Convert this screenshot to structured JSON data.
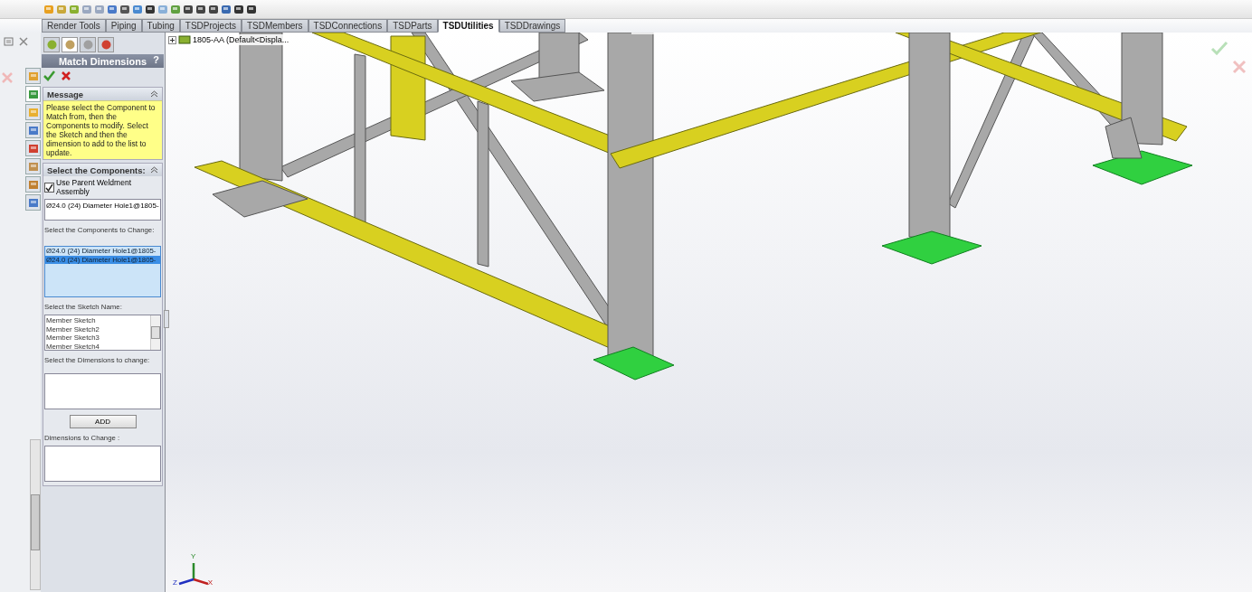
{
  "tabs": [
    {
      "label": "Render Tools",
      "selected": false
    },
    {
      "label": "Piping",
      "selected": false
    },
    {
      "label": "Tubing",
      "selected": false
    },
    {
      "label": "TSDProjects",
      "selected": false
    },
    {
      "label": "TSDMembers",
      "selected": false
    },
    {
      "label": "TSDConnections",
      "selected": false
    },
    {
      "label": "TSDParts",
      "selected": false
    },
    {
      "label": "TSDUtilities",
      "selected": true
    },
    {
      "label": "TSDDrawings",
      "selected": false
    }
  ],
  "side_tabs": [
    {
      "selected": false
    },
    {
      "selected": true
    },
    {
      "selected": false
    },
    {
      "selected": false
    },
    {
      "selected": false
    },
    {
      "selected": false
    },
    {
      "selected": false
    },
    {
      "selected": false
    }
  ],
  "panel_tabs": [
    {
      "selected": false
    },
    {
      "selected": true
    },
    {
      "selected": false
    },
    {
      "selected": false
    }
  ],
  "panel": {
    "title": "Match Dimensions",
    "help": "?",
    "message": {
      "heading": "Message",
      "text": "Please select the Component to Match from, then the Components to modify. Select the Sketch and then the dimension to add to the list to update."
    },
    "components": {
      "heading": "Select the Components:",
      "checkbox": {
        "label": "Use Parent Weldment Assembly",
        "checked": true
      },
      "field_value": "Ø24.0 (24) Diameter Hole1@1805-",
      "change_label": "Select the Components to Change:",
      "change_items": [
        {
          "text": "Ø24.0 (24) Diameter Hole1@1805-",
          "selected": false
        },
        {
          "text": "Ø24.0 (24) Diameter Hole1@1805-",
          "selected": true
        }
      ],
      "sketch_label": "Select the Sketch Name:",
      "sketch_items": [
        "Member Sketch",
        "Member Sketch2",
        "Member Sketch3",
        "Member Sketch4"
      ],
      "dimensions_label": "Select the Dimensions to change:",
      "add_button": "ADD",
      "to_change_label": "Dimensions to Change :"
    }
  },
  "tree": {
    "root": "1805-AA  (Default<Displa..."
  },
  "triad": {
    "x": "X",
    "y": "Y",
    "z": "Z"
  }
}
